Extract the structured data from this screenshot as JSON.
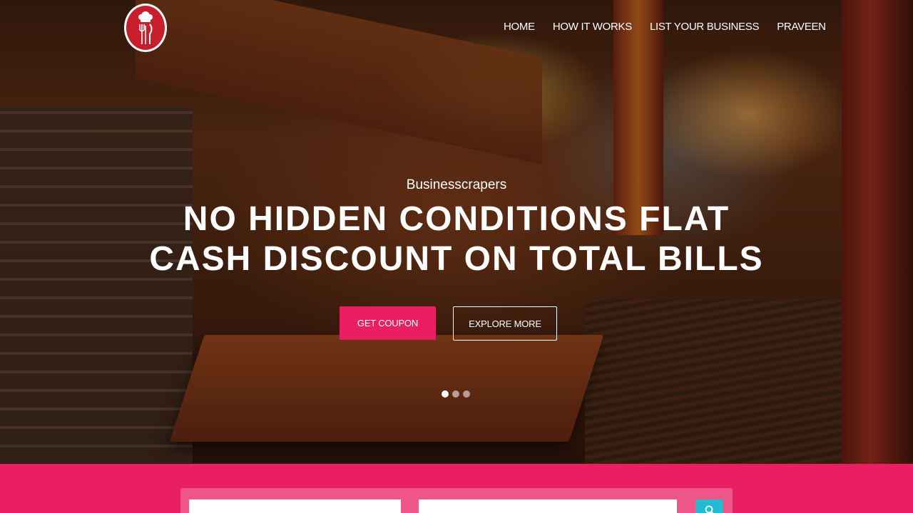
{
  "nav": {
    "items": [
      {
        "label": "HOME"
      },
      {
        "label": "HOW IT WORKS"
      },
      {
        "label": "LIST YOUR BUSINESS"
      },
      {
        "label": "PRAVEEN"
      }
    ]
  },
  "logo": {
    "icon": "chef-hat-fork-knife-icon"
  },
  "hero": {
    "subtitle": "Businesscrapers",
    "title": "NO HIDDEN CONDITIONS FLAT CASH DISCOUNT ON TOTAL BILLS",
    "primary_button": "GET COUPON",
    "secondary_button": "EXPLORE MORE",
    "slides": 3,
    "active_slide": 1
  },
  "search": {
    "what_placeholder": "",
    "where_placeholder": "",
    "button_icon": "search-icon"
  },
  "colors": {
    "accent": "#e91e63",
    "search_button": "#22bcd0",
    "logo": "#c71f2b"
  }
}
